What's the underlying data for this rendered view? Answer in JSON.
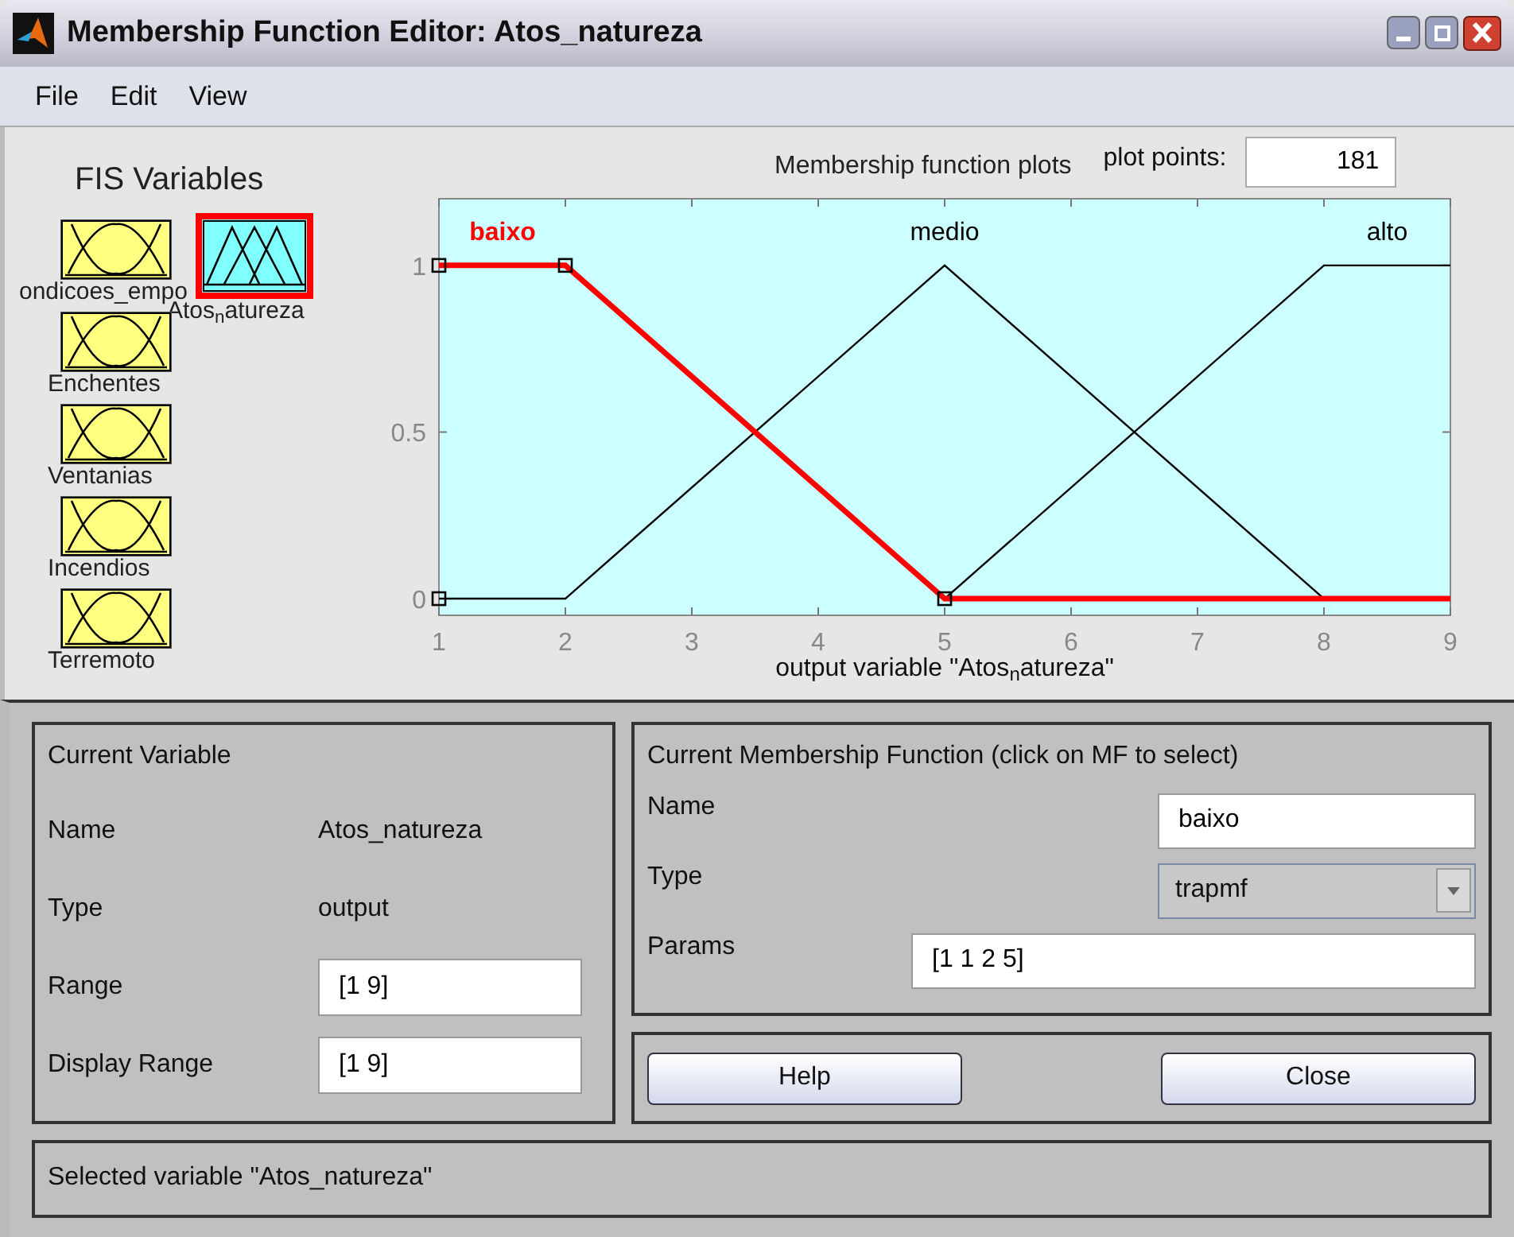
{
  "window": {
    "title": "Membership Function Editor: Atos_natureza"
  },
  "menu": [
    "File",
    "Edit",
    "View"
  ],
  "fis_variables": {
    "title": "FIS Variables",
    "items": [
      {
        "label": "ondicoes_empo",
        "kind": "input",
        "selected": false
      },
      {
        "label": "Atos$_{n}$atureza",
        "kind": "output",
        "selected": true
      },
      {
        "label": "Enchentes",
        "kind": "input",
        "selected": false
      },
      {
        "label": "Ventanias",
        "kind": "input",
        "selected": false
      },
      {
        "label": "Incendios",
        "kind": "input",
        "selected": false
      },
      {
        "label": "Terremoto",
        "kind": "input",
        "selected": false
      }
    ]
  },
  "plot": {
    "title": "Membership function plots",
    "plot_points_label": "plot points:",
    "plot_points": "181",
    "chart_data": {
      "type": "line",
      "xlabel": "output variable \"Atos$_{n}$atureza\"",
      "x": [
        1,
        2,
        5,
        8,
        9
      ],
      "xlim": [
        1,
        9
      ],
      "ylim": [
        -0.05,
        1.2
      ],
      "xticks": [
        1,
        2,
        3,
        4,
        5,
        6,
        7,
        8,
        9
      ],
      "yticks": [
        0,
        0.5,
        1
      ],
      "series": [
        {
          "name": "baixo",
          "color": "#ff0000",
          "values": [
            1,
            1,
            0,
            0,
            0
          ]
        },
        {
          "name": "medio",
          "color": "#000000",
          "values": [
            0,
            0,
            1,
            0,
            null
          ]
        },
        {
          "name": "alto",
          "color": "#000000",
          "values": [
            null,
            null,
            0,
            1,
            1
          ]
        }
      ]
    },
    "curves": [
      {
        "selected": true
      },
      {
        "selected": false
      },
      {
        "selected": false
      }
    ]
  },
  "current_variable": {
    "title": "Current Variable",
    "rows": [
      {
        "label": "Name",
        "value": "Atos_natureza",
        "kind": "text"
      },
      {
        "label": "Type",
        "value": "output",
        "kind": "text"
      },
      {
        "label": "Range",
        "value": "[1 9]",
        "kind": "field"
      },
      {
        "label": "Display Range",
        "value": "[1 9]",
        "kind": "field"
      }
    ]
  },
  "current_mf": {
    "title": "Current Membership Function (click on MF to select)",
    "rows": [
      {
        "label": "Name",
        "value": "baixo",
        "kind": "field"
      },
      {
        "label": "Type",
        "value": "trapmf",
        "kind": "dropdown"
      },
      {
        "label": "Params",
        "value": "[1 1 2 5]",
        "kind": "wide_field"
      }
    ]
  },
  "buttons": [
    "Help",
    "Close"
  ],
  "status": "Selected variable \"Atos_natureza\""
}
